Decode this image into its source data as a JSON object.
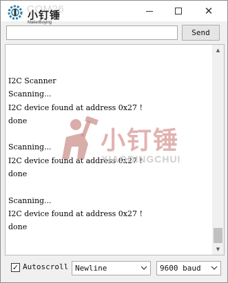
{
  "window": {
    "title": "COM26",
    "brand_name": "小钉锤",
    "brand_sub": "MakerBuying"
  },
  "send": {
    "input_value": "",
    "button_label": "Send"
  },
  "output": {
    "lines": [
      "I2C Scanner",
      "Scanning...",
      "I2C device found at address 0x27 !",
      "done",
      "",
      "Scanning...",
      "I2C device found at address 0x27 !",
      "done",
      "",
      "Scanning...",
      "I2C device found at address 0x27 !",
      "done"
    ]
  },
  "watermark": {
    "cn": "小钉锤",
    "en": "XIAODINGCHUI"
  },
  "footer": {
    "autoscroll_label": "Autoscroll",
    "autoscroll_checked": true,
    "autoscroll_mark": "✓",
    "line_ending": "Newline",
    "baud_rate": "9600 baud"
  },
  "colors": {
    "watermark_red": "#d69a96",
    "watermark_gray": "#cfcfcf"
  },
  "icons": {
    "app": "gear-logo-icon",
    "minimize": "minimize-icon",
    "maximize": "maximize-icon",
    "close": "close-icon",
    "dropdown": "chevron-down-icon"
  }
}
